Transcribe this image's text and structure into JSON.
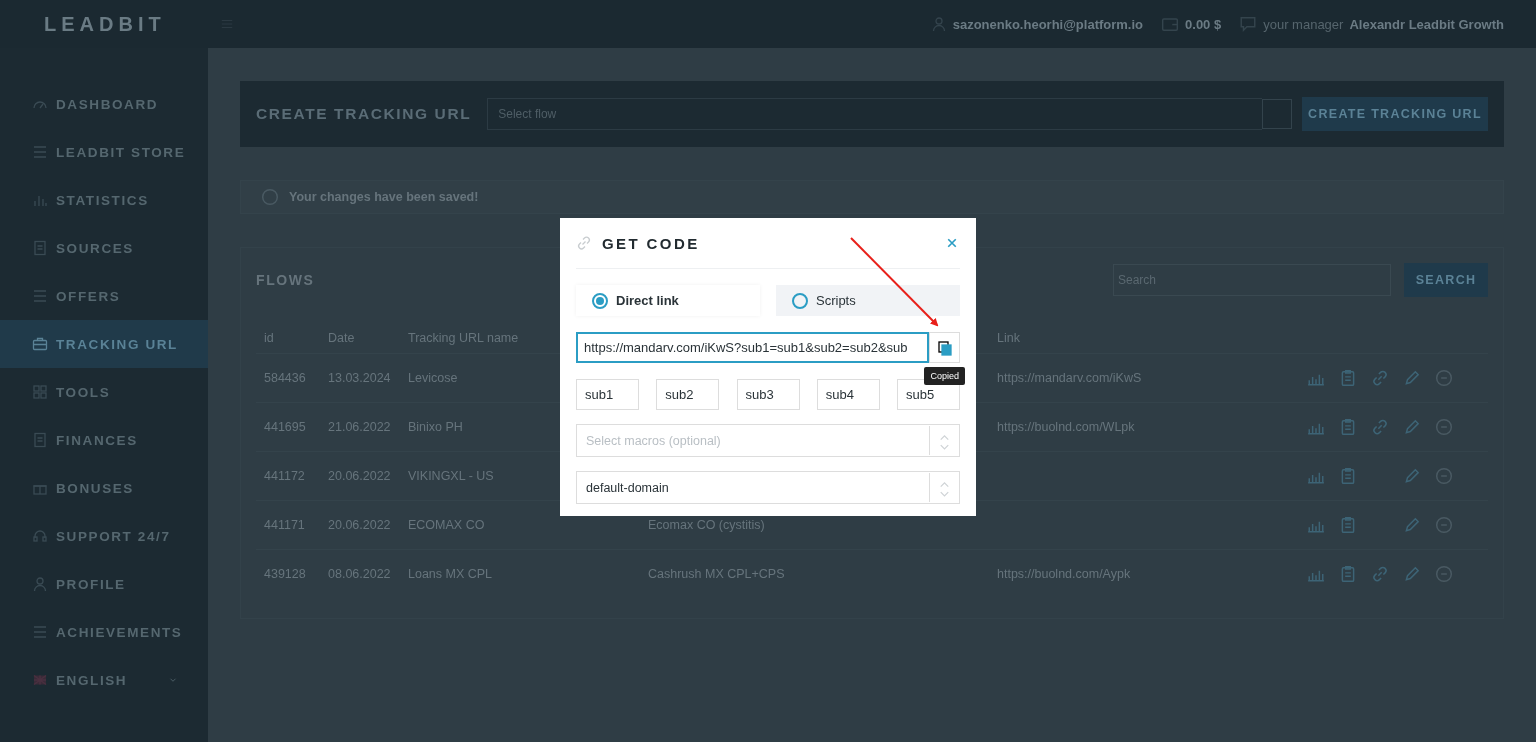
{
  "topbar": {
    "logo": "LEADBIT",
    "email": "sazonenko.heorhi@platform.io",
    "balance": "0.00 $",
    "manager_label": "your manager",
    "manager": "Alexandr Leadbit Growth"
  },
  "sidebar": {
    "items": [
      {
        "label": "DASHBOARD",
        "selected": false
      },
      {
        "label": "LEADBIT STORE",
        "selected": false
      },
      {
        "label": "STATISTICS",
        "selected": false
      },
      {
        "label": "SOURCES",
        "selected": false
      },
      {
        "label": "OFFERS",
        "selected": false
      },
      {
        "label": "TRACKING URL",
        "selected": true
      },
      {
        "label": "TOOLS",
        "selected": false
      },
      {
        "label": "FINANCES",
        "selected": false
      },
      {
        "label": "BONUSES",
        "selected": false
      },
      {
        "label": "SUPPORT 24/7",
        "selected": false
      },
      {
        "label": "PROFILE",
        "selected": false
      },
      {
        "label": "ACHIEVEMENTS",
        "selected": false
      }
    ],
    "language": {
      "label": "ENGLISH"
    }
  },
  "create_panel": {
    "title": "CREATE TRACKING URL",
    "select_placeholder": "Select flow",
    "button": "CREATE TRACKING URL"
  },
  "notice": "Your changes have been saved!",
  "flows": {
    "title": "FLOWS",
    "search_placeholder": "Search",
    "search_button": "SEARCH",
    "columns": {
      "id": "id",
      "date": "Date",
      "name": "Tracking URL name",
      "link": "Link"
    },
    "rows": [
      {
        "id": "584436",
        "date": "13.03.2024",
        "name": "Levicose",
        "link": "https://mandarv.com/iKwS",
        "has_link_action": true
      },
      {
        "id": "441695",
        "date": "21.06.2022",
        "name": "Binixo PH",
        "link": "https://buolnd.com/WLpk",
        "has_link_action": true
      },
      {
        "id": "441172",
        "date": "20.06.2022",
        "name": "VIKINGXL - US",
        "has_link_action": false
      },
      {
        "id": "441171",
        "date": "20.06.2022",
        "name": "ECOMAX CO",
        "flow": "Ecomax CO (cystitis)",
        "has_link_action": false
      },
      {
        "id": "439128",
        "date": "08.06.2022",
        "name": "Loans MX CPL",
        "flow": "Cashrush MX CPL+CPS",
        "link": "https://buolnd.com/Aypk",
        "has_link_action": true
      }
    ]
  },
  "modal": {
    "title": "GET CODE",
    "modes": [
      {
        "label": "Direct link",
        "selected": true
      },
      {
        "label": "Scripts",
        "selected": false
      }
    ],
    "url": "https://mandarv.com/iKwS?sub1=sub1&sub2=sub2&sub",
    "copy_tooltip": "Copied",
    "subs": [
      "sub1",
      "sub2",
      "sub3",
      "sub4",
      "sub5"
    ],
    "macros_placeholder": "Select macros (optional)",
    "domain": "default-domain"
  }
}
